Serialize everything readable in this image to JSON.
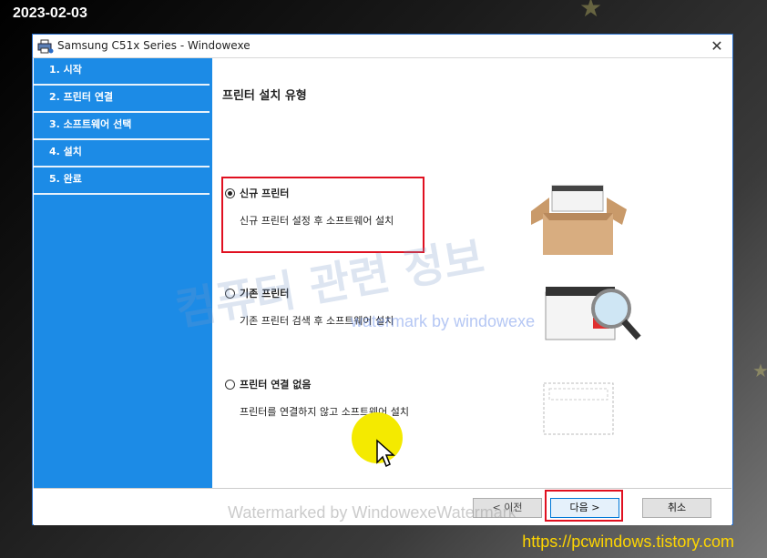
{
  "overlay": {
    "date": "2023-02-03",
    "url": "https://pcwindows.tistory.com",
    "watermark_large": "컴퓨터 관련 정보",
    "watermark_small": "watermark by windowexe",
    "watermark_bottom": "Watermarked by WindowexeWatermark"
  },
  "window": {
    "title": "Samsung C51x Series    - Windowexe",
    "close_glyph": "✕"
  },
  "sidebar": {
    "steps": [
      {
        "label": "1. 시작"
      },
      {
        "label": "2. 프린터 연결"
      },
      {
        "label": "3. 소프트웨어 선택"
      },
      {
        "label": "4. 설치"
      },
      {
        "label": "5. 완료"
      }
    ]
  },
  "content": {
    "heading": "프린터 설치 유형",
    "options": [
      {
        "label": "신규 프린터",
        "description": "신규 프린터 설정 후 소프트웨어 설치",
        "selected": true
      },
      {
        "label": "기존 프린터",
        "description": "기존 프린터 검색 후 소프트웨어 설치",
        "selected": false
      },
      {
        "label": "프린터 연결 없음",
        "description": "프린터를 연결하지 않고 소프트웨어 설치",
        "selected": false
      }
    ]
  },
  "footer": {
    "prev_label": "< 이전",
    "next_label": "다음 >",
    "cancel_label": "취소"
  },
  "colors": {
    "sidebar": "#1c8be6",
    "highlight": "#e01020",
    "cursor_halo": "#f4ea00",
    "url": "#ffd600"
  }
}
